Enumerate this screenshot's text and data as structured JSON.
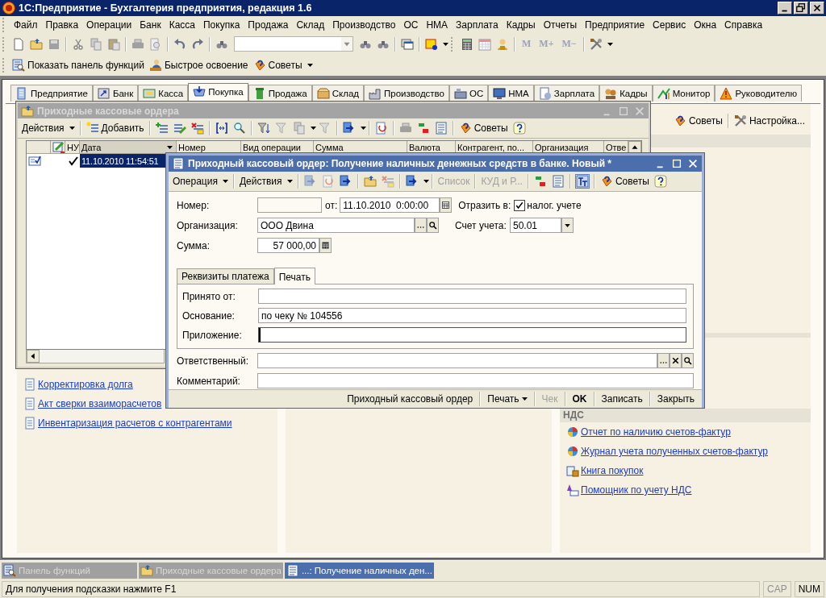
{
  "app_window": {
    "title": "1С:Предприятие - Бухгалтерия предприятия, редакция 1.6"
  },
  "menu": [
    "Файл",
    "Правка",
    "Операции",
    "Банк",
    "Касса",
    "Покупка",
    "Продажа",
    "Склад",
    "Производство",
    "ОС",
    "НМА",
    "Зарплата",
    "Кадры",
    "Отчеты",
    "Предприятие",
    "Сервис",
    "Окна",
    "Справка"
  ],
  "toolbar": {
    "memory_buttons": [
      {
        "label": "M",
        "disabled": true
      },
      {
        "label": "M+",
        "disabled": true
      },
      {
        "label": "M−",
        "disabled": true
      }
    ]
  },
  "quick_bar": [
    "Показать панель функций",
    "Быстрое освоение",
    "Советы"
  ],
  "function_panel": {
    "tabs": [
      {
        "label": "Предприятие",
        "selected": false
      },
      {
        "label": "Банк",
        "selected": false
      },
      {
        "label": "Касса",
        "selected": false
      },
      {
        "label": "Покупка",
        "selected": true
      },
      {
        "label": "Продажа",
        "selected": false
      },
      {
        "label": "Склад",
        "selected": false
      },
      {
        "label": "Производство",
        "selected": false
      },
      {
        "label": "ОС",
        "selected": false
      },
      {
        "label": "НМА",
        "selected": false
      },
      {
        "label": "Зарплата",
        "selected": false
      },
      {
        "label": "Кадры",
        "selected": false
      },
      {
        "label": "Монитор",
        "selected": false
      },
      {
        "label": "Руководителю",
        "selected": false
      }
    ],
    "tips_button": "Советы",
    "settings_button": "Настройка...",
    "links": [
      "Корректировка долга",
      "Акт сверки взаиморасчетов",
      "Инвентаризация расчетов с контрагентами"
    ],
    "vat_section": {
      "title": "НДС",
      "links": [
        "Отчет по наличию счетов-фактур",
        "Журнал учета полученных счетов-фактур",
        "Книга покупок",
        "Помощник по учету НДС"
      ]
    }
  },
  "list_window": {
    "title": "Приходные кассовые ордера",
    "active": false,
    "toolbar": {
      "actions": "Действия",
      "add": "Добавить",
      "tips": "Советы"
    },
    "columns": [
      "НУ",
      "Дата",
      "Номер",
      "Вид операции",
      "Сумма",
      "Валюта",
      "Контрагент, по...",
      "Организация",
      "Отве"
    ],
    "rows": [
      {
        "nu": true,
        "date": "11.10.2010 11:54:51",
        "selected": true
      }
    ]
  },
  "doc_window": {
    "title": "Приходный кассовый ордер: Получение наличных денежных средств в банке. Новый *",
    "active": true,
    "toolbar": {
      "operation": "Операция",
      "actions": "Действия",
      "list": {
        "label": "Список",
        "disabled": true
      },
      "kud": {
        "label": "КУД и Р...",
        "disabled": true
      },
      "tips": "Советы"
    },
    "number": {
      "label": "Номер:"
    },
    "date": {
      "label": "от:",
      "value": "11.10.2010  0:00:00"
    },
    "reflect": {
      "label": "Отразить в:",
      "option": "налог. учете",
      "checked": true
    },
    "organization": {
      "label": "Организация:",
      "value": "ООО Двина"
    },
    "account": {
      "label": "Счет учета:",
      "value": "50.01"
    },
    "amount": {
      "label": "Сумма:",
      "value": "57 000,00"
    },
    "tabs": [
      {
        "label": "Реквизиты платежа",
        "selected": false
      },
      {
        "label": "Печать",
        "selected": true
      }
    ],
    "print_fields": [
      {
        "label": "Принято от:",
        "focused": false
      },
      {
        "label": "Основание:",
        "value": "по чеку № 104556",
        "focused": false
      },
      {
        "label": "Приложение:",
        "focused": true
      }
    ],
    "responsible": {
      "label": "Ответственный:"
    },
    "comment": {
      "label": "Комментарий:"
    },
    "buttons": [
      {
        "label": "Приходный кассовый ордер",
        "dropdown": false,
        "disabled": false,
        "default": false
      },
      {
        "label": "Печать",
        "dropdown": true,
        "disabled": false,
        "default": false
      },
      {
        "label": "Чек",
        "dropdown": false,
        "disabled": true,
        "default": false
      },
      {
        "label": "OK",
        "dropdown": false,
        "disabled": false,
        "default": true
      },
      {
        "label": "Записать",
        "dropdown": false,
        "disabled": false,
        "default": false
      },
      {
        "label": "Закрыть",
        "dropdown": false,
        "disabled": false,
        "default": false
      }
    ]
  },
  "taskbar": [
    {
      "label": "Панель функций",
      "selected": false
    },
    {
      "label": "Приходные кассовые ордера",
      "selected": false
    },
    {
      "label": "...: Получение наличных ден...",
      "selected": true
    }
  ],
  "status_bar": {
    "hint": "Для получения подсказки нажмите F1",
    "indicators": [
      "CAP",
      "NUM"
    ]
  }
}
